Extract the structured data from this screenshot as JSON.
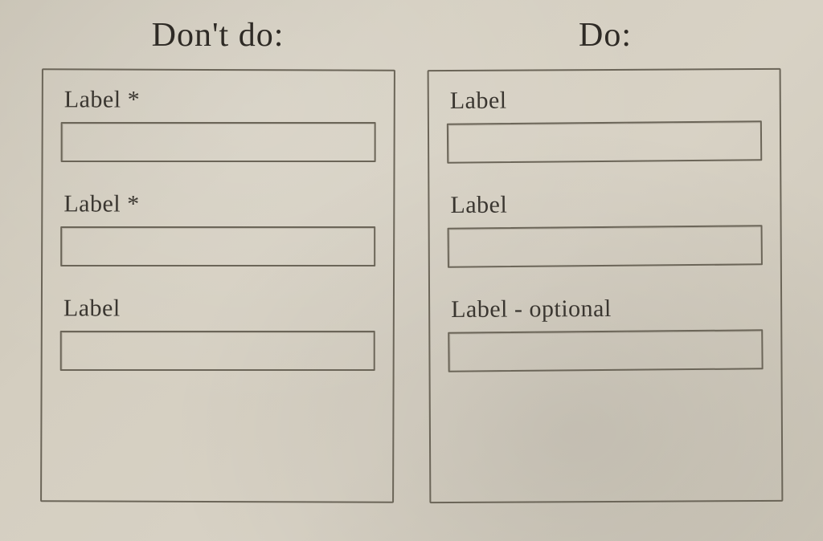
{
  "left": {
    "heading": "Don't do:",
    "fields": [
      {
        "label": "Label *"
      },
      {
        "label": "Label *"
      },
      {
        "label": "Label"
      }
    ]
  },
  "right": {
    "heading": "Do:",
    "fields": [
      {
        "label": "Label"
      },
      {
        "label": "Label"
      },
      {
        "label": "Label - optional"
      }
    ]
  }
}
